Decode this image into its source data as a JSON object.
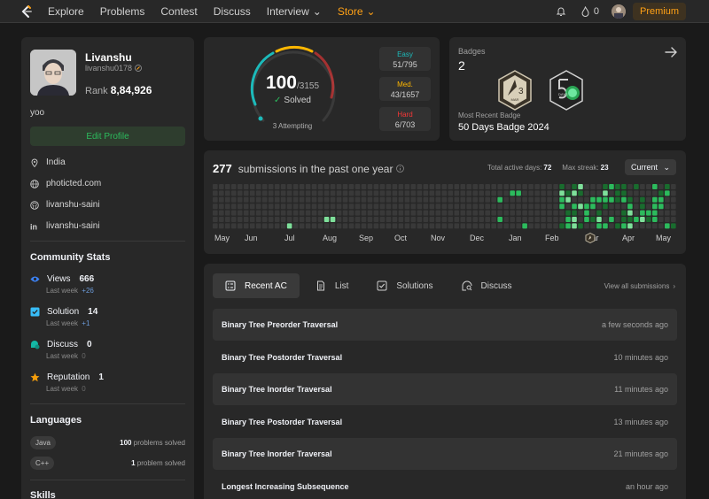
{
  "nav": {
    "items": [
      "Explore",
      "Problems",
      "Contest",
      "Discuss",
      "Interview",
      "Store"
    ],
    "coins": "0",
    "premium_label": "Premium"
  },
  "profile": {
    "name": "Livanshu",
    "handle": "livanshu0178",
    "rank_label": "Rank",
    "rank_value": "8,84,926",
    "bio": "yoo",
    "edit_label": "Edit Profile",
    "location": "India",
    "website": "photicted.com",
    "github": "livanshu-saini",
    "linkedin": "livanshu-saini"
  },
  "community": {
    "title": "Community Stats",
    "stats": [
      {
        "label": "Views",
        "value": "666",
        "sub": "Last week",
        "delta": "+26",
        "color": "#3b82f6"
      },
      {
        "label": "Solution",
        "value": "14",
        "sub": "Last week",
        "delta": "+1",
        "color": "#38bdf8"
      },
      {
        "label": "Discuss",
        "value": "0",
        "sub": "Last week",
        "delta": "0",
        "color": "#14b8a6"
      },
      {
        "label": "Reputation",
        "value": "1",
        "sub": "Last week",
        "delta": "0",
        "color": "#f59e0b"
      }
    ]
  },
  "languages": {
    "title": "Languages",
    "items": [
      {
        "name": "Java",
        "count": "100",
        "suffix": "problems solved"
      },
      {
        "name": "C++",
        "count": "1",
        "suffix": "problem solved"
      }
    ]
  },
  "skills_title": "Skills",
  "solved": {
    "count": "100",
    "total": "/3155",
    "solved_label": "Solved",
    "attempting": "3 Attempting",
    "difficulty": [
      {
        "label": "Easy",
        "value": "51/795",
        "color": "#1cbaba"
      },
      {
        "label": "Med.",
        "value": "43/1657",
        "color": "#ffb700"
      },
      {
        "label": "Hard",
        "value": "6/703",
        "color": "#f63737"
      }
    ]
  },
  "badges": {
    "title": "Badges",
    "count": "2",
    "badge1_month": "MAR",
    "badge1_num": "3",
    "badge2_label": "DAYS",
    "recent_label": "Most Recent Badge",
    "recent_value": "50 Days Badge 2024"
  },
  "heatmap": {
    "count": "277",
    "text": "submissions in the past one year",
    "active_label": "Total active days:",
    "active_value": "72",
    "streak_label": "Max streak:",
    "streak_value": "23",
    "dropdown": "Current",
    "months": [
      "May",
      "Jun",
      "Jul",
      "Aug",
      "Sep",
      "Oct",
      "Nov",
      "Dec",
      "Jan",
      "Feb",
      "Mar",
      "Apr",
      "May"
    ]
  },
  "recent": {
    "tabs": [
      "Recent AC",
      "List",
      "Solutions",
      "Discuss"
    ],
    "view_all": "View all submissions",
    "rows": [
      {
        "title": "Binary Tree Preorder Traversal",
        "time": "a few seconds ago"
      },
      {
        "title": "Binary Tree Postorder Traversal",
        "time": "10 minutes ago"
      },
      {
        "title": "Binary Tree Inorder Traversal",
        "time": "11 minutes ago"
      },
      {
        "title": "Binary Tree Postorder Traversal",
        "time": "13 minutes ago"
      },
      {
        "title": "Binary Tree Inorder Traversal",
        "time": "21 minutes ago"
      },
      {
        "title": "Longest Increasing Subsequence",
        "time": "an hour ago"
      }
    ]
  }
}
